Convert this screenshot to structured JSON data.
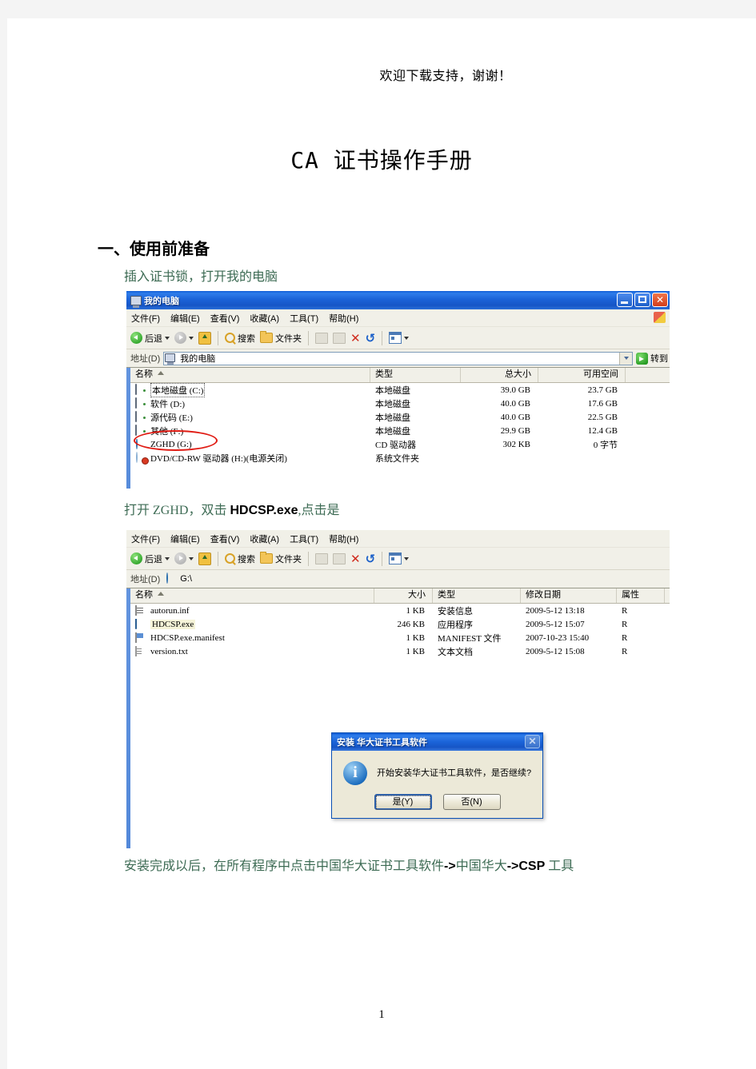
{
  "document": {
    "header_note": "欢迎下载支持，谢谢！",
    "title": "CA 证书操作手册",
    "section_1_heading": "一、使用前准备",
    "step_1_text": "插入证书锁，打开我的电脑",
    "step_2_text_cn1": "打开 ZGHD，双击 ",
    "step_2_text_en": "HDCSP.exe",
    "step_2_text_cn2": ",点击是",
    "step_3_text_cn1": "安装完成以后，在所有程序中点击中国华大证书工具软件",
    "step_3_text_en1": "->",
    "step_3_text_cn2": "中国华大",
    "step_3_text_en2": "->CSP",
    "step_3_text_cn3": " 工具",
    "page_number": "1"
  },
  "window_my_computer": {
    "title": "我的电脑",
    "menu": [
      "文件(F)",
      "编辑(E)",
      "查看(V)",
      "收藏(A)",
      "工具(T)",
      "帮助(H)"
    ],
    "toolbar": {
      "back": "后退",
      "search": "搜索",
      "folders": "文件夹"
    },
    "address": {
      "label": "地址(D)",
      "value": "我的电脑",
      "go_label": "转到"
    },
    "columns": [
      "名称",
      "类型",
      "总大小",
      "可用空间"
    ],
    "rows": [
      {
        "name": "本地磁盘 (C:)",
        "type": "本地磁盘",
        "size": "39.0 GB",
        "free": "23.7 GB",
        "icon": "hdd-icon"
      },
      {
        "name": "软件 (D:)",
        "type": "本地磁盘",
        "size": "40.0 GB",
        "free": "17.6 GB",
        "icon": "hdd-icon"
      },
      {
        "name": "源代码 (E:)",
        "type": "本地磁盘",
        "size": "40.0 GB",
        "free": "22.5 GB",
        "icon": "hdd-icon"
      },
      {
        "name": "其他 (F:)",
        "type": "本地磁盘",
        "size": "29.9 GB",
        "free": "12.4 GB",
        "icon": "hdd-icon"
      },
      {
        "name": "ZGHD (G:)",
        "type": "CD 驱动器",
        "size": "302 KB",
        "free": "0 字节",
        "icon": "cd-icon"
      },
      {
        "name": "DVD/CD-RW 驱动器 (H:)(电源关闭)",
        "type": "系统文件夹",
        "size": "",
        "free": "",
        "icon": "cd-disabled-icon"
      }
    ]
  },
  "window_g_drive": {
    "menu": [
      "文件(F)",
      "编辑(E)",
      "查看(V)",
      "收藏(A)",
      "工具(T)",
      "帮助(H)"
    ],
    "toolbar": {
      "back": "后退",
      "search": "搜索",
      "folders": "文件夹"
    },
    "address": {
      "label": "地址(D)",
      "value": "G:\\"
    },
    "columns": [
      "名称",
      "大小",
      "类型",
      "修改日期",
      "属性"
    ],
    "rows": [
      {
        "name": "autorun.inf",
        "size": "1 KB",
        "type": "安装信息",
        "date": "2009-5-12 13:18",
        "attr": "R",
        "icon": "inf-file-icon"
      },
      {
        "name": "HDCSP.exe",
        "size": "246 KB",
        "type": "应用程序",
        "date": "2009-5-12 15:07",
        "attr": "R",
        "icon": "exe-file-icon"
      },
      {
        "name": "HDCSP.exe.manifest",
        "size": "1 KB",
        "type": "MANIFEST 文件",
        "date": "2007-10-23 15:40",
        "attr": "R",
        "icon": "manifest-file-icon"
      },
      {
        "name": "version.txt",
        "size": "1 KB",
        "type": "文本文档",
        "date": "2009-5-12 15:08",
        "attr": "R",
        "icon": "text-file-icon"
      }
    ]
  },
  "dialog_install": {
    "title": "安装 华大证书工具软件",
    "message": "开始安装华大证书工具软件，是否继续?",
    "yes_label": "是(Y)",
    "no_label": "否(N)",
    "icon": "info-icon"
  },
  "colors": {
    "titlebar_blue": "#1b63d8",
    "annotation_red": "#e01b13",
    "chrome_beige": "#f1f0e8",
    "green_text": "#3d6b54"
  }
}
